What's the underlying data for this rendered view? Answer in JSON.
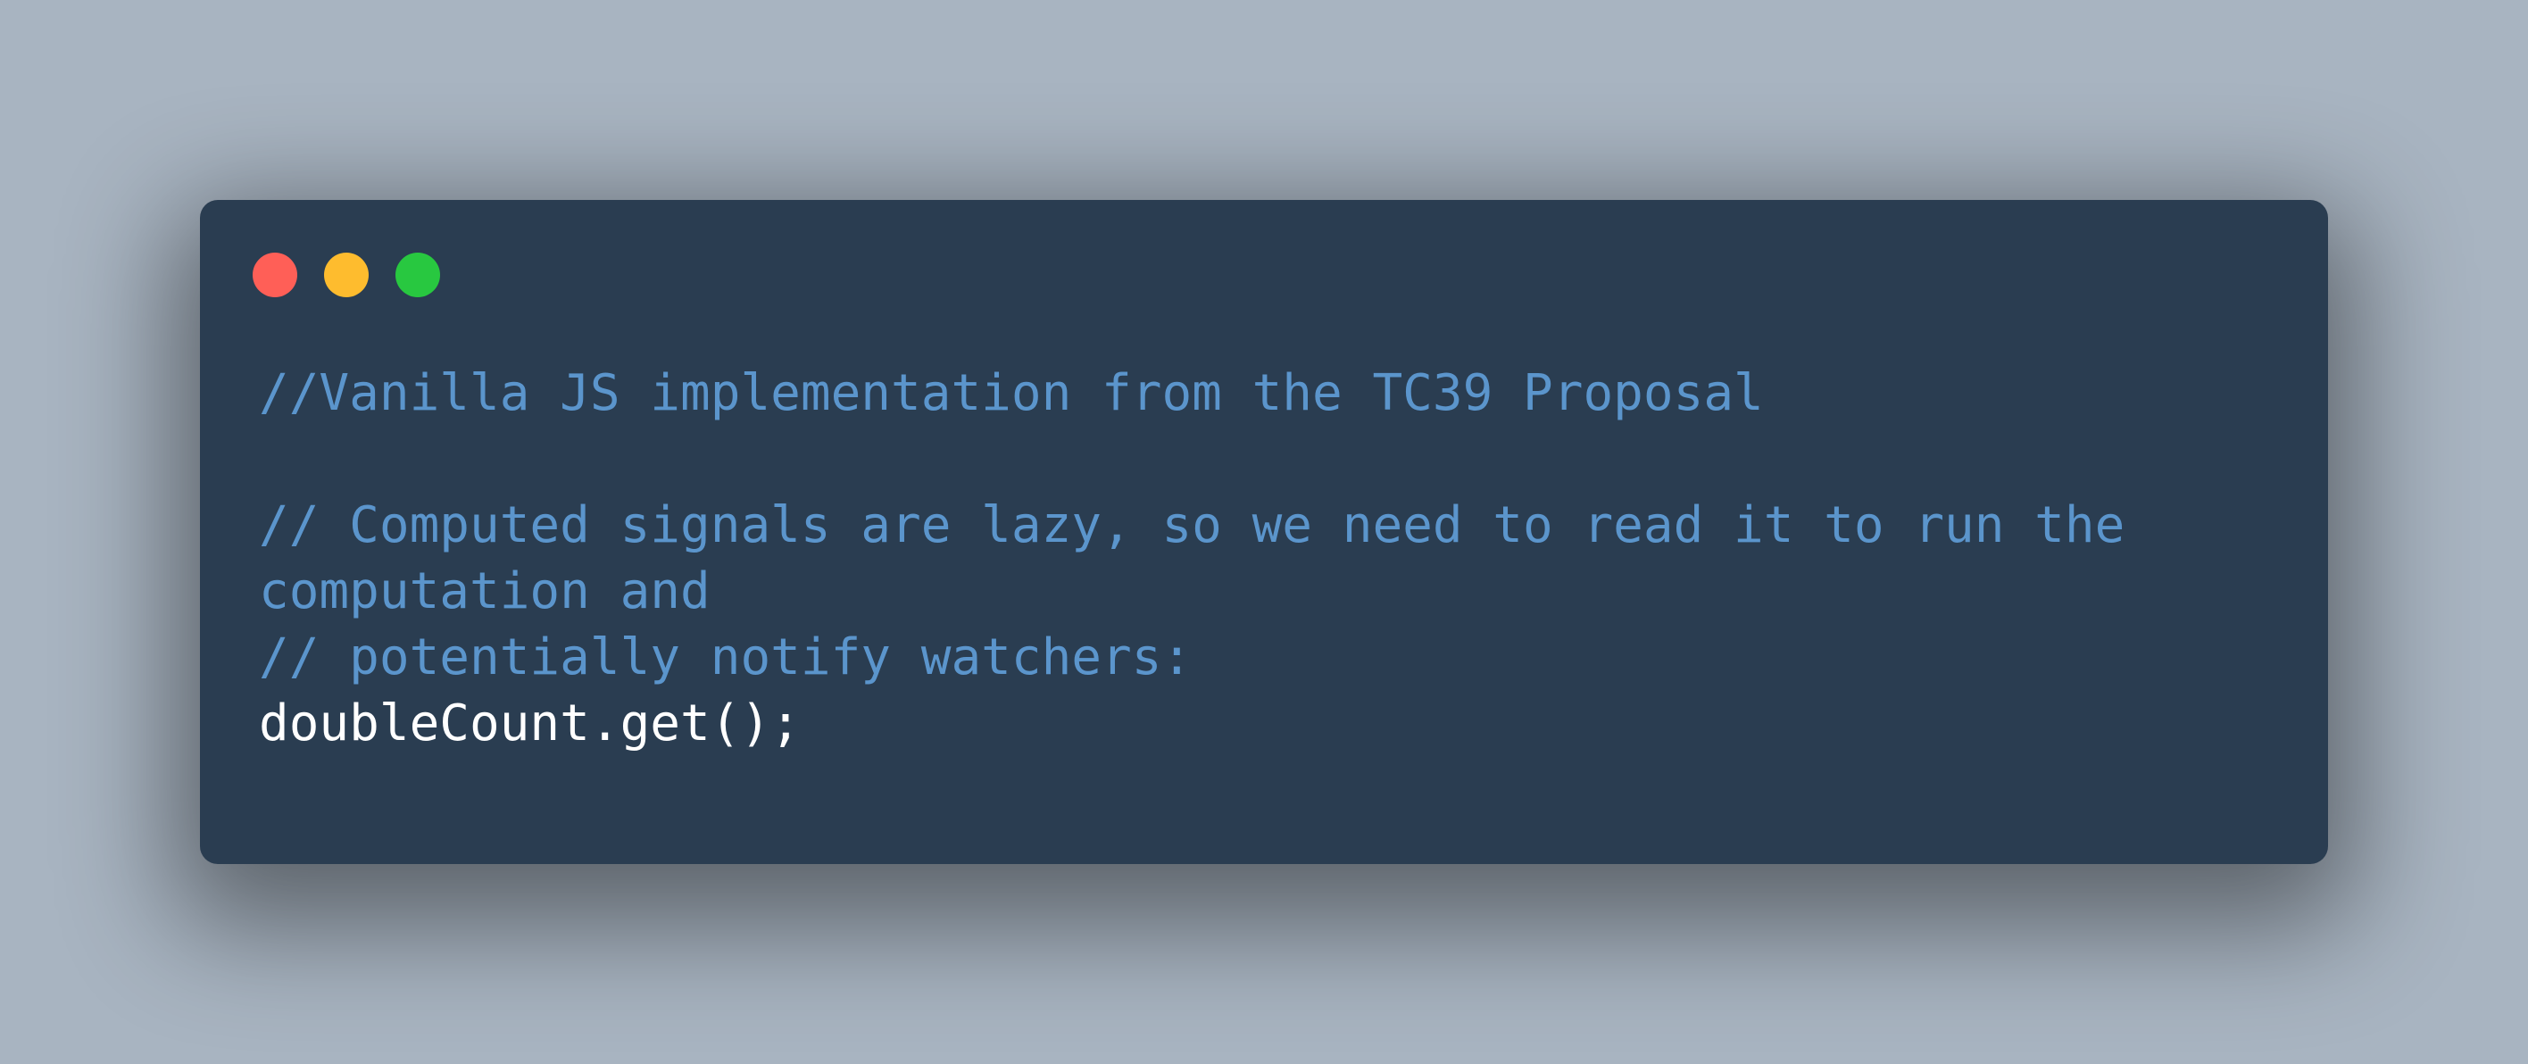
{
  "window": {
    "controls": {
      "close_color": "#ff5f57",
      "minimize_color": "#febc2e",
      "maximize_color": "#28c840"
    }
  },
  "code": {
    "lines": [
      {
        "text": "//Vanilla JS implementation from the TC39 Proposal",
        "kind": "comment"
      },
      {
        "text": "",
        "kind": "blank"
      },
      {
        "text": "// Computed signals are lazy, so we need to read it to run the",
        "kind": "comment"
      },
      {
        "text": "computation and",
        "kind": "comment"
      },
      {
        "text": "// potentially notify watchers:",
        "kind": "comment"
      },
      {
        "text": "doubleCount.get();",
        "kind": "plain"
      }
    ],
    "colors": {
      "comment": "#5b95cc",
      "plain": "#ffffff",
      "background": "#2a3d51"
    }
  }
}
